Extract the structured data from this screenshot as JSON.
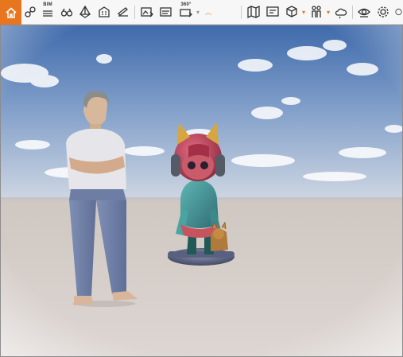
{
  "colors": {
    "accent": "#e8761f",
    "toolbar_bg": "#f7f7f7",
    "sky_top": "#4f78b4",
    "ground": "#d7cfcb"
  },
  "toolbar": {
    "home": {
      "icon": "home-icon",
      "active": true
    },
    "groups": [
      [
        "link-icon",
        "bim-icon",
        "binoculars-icon",
        "box-3d-icon",
        "building-icon",
        "draw-icon"
      ],
      [
        "render-image-icon",
        "render-panorama-icon",
        "render-360-icon",
        "collapse-caret-icon"
      ],
      [
        "map-icon",
        "display-icon",
        "cube-icon",
        "figures-icon",
        "weather-icon"
      ],
      [
        "visibility-icon",
        "settings-icon",
        "overflow-icon"
      ]
    ],
    "bim_label": "BIM",
    "render_360_label": "360°"
  },
  "viewport": {
    "scene": "3d-viewport",
    "objects": [
      "human-figure",
      "figurine-girl-headphones",
      "figurine-cat"
    ]
  }
}
